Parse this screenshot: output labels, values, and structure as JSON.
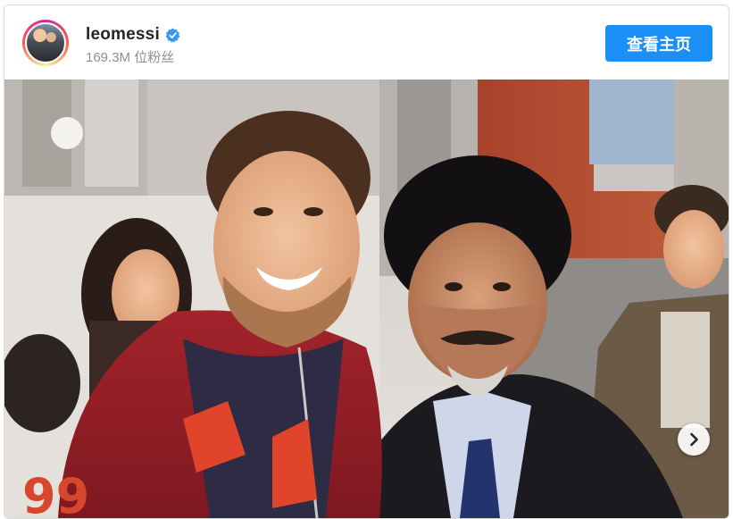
{
  "post": {
    "username": "leomessi",
    "verified": true,
    "followers_text": "169.3M 位粉丝",
    "profile_button_label": "查看主页"
  },
  "photo": {
    "jersey_number": "99"
  },
  "icons": {
    "verified": "verified-badge-icon",
    "next": "chevron-right-icon"
  },
  "colors": {
    "accent": "#1a8ff5",
    "verified": "#3897f0",
    "username": "#262626",
    "secondary_text": "#8e8e8e"
  }
}
